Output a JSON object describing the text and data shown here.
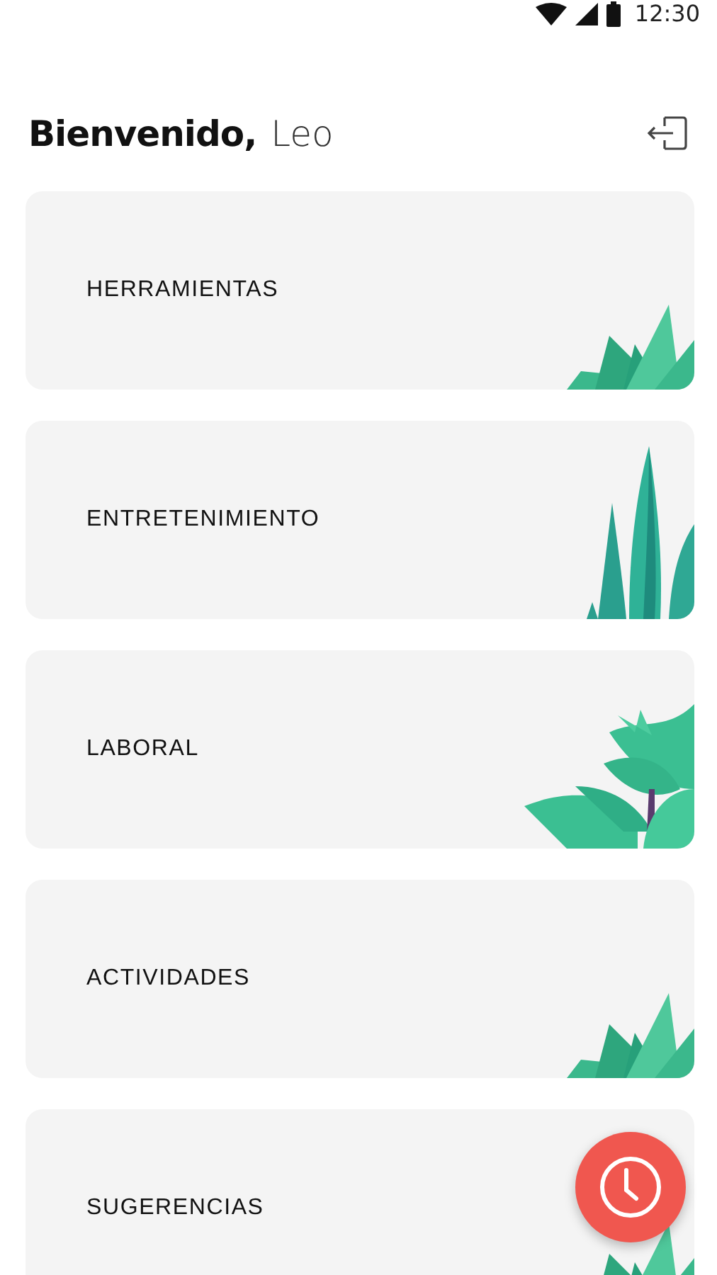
{
  "status_bar": {
    "time": "12:30"
  },
  "header": {
    "greeting": "Bienvenido,",
    "name": "Leo"
  },
  "cards": [
    {
      "label": "HERRAMIENTAS",
      "kind": "grass"
    },
    {
      "label": "ENTRETENIMIENTO",
      "kind": "tall"
    },
    {
      "label": "LABORAL",
      "kind": "leafy"
    },
    {
      "label": "ACTIVIDADES",
      "kind": "grass"
    },
    {
      "label": "SUGERENCIAS",
      "kind": "grass"
    }
  ]
}
